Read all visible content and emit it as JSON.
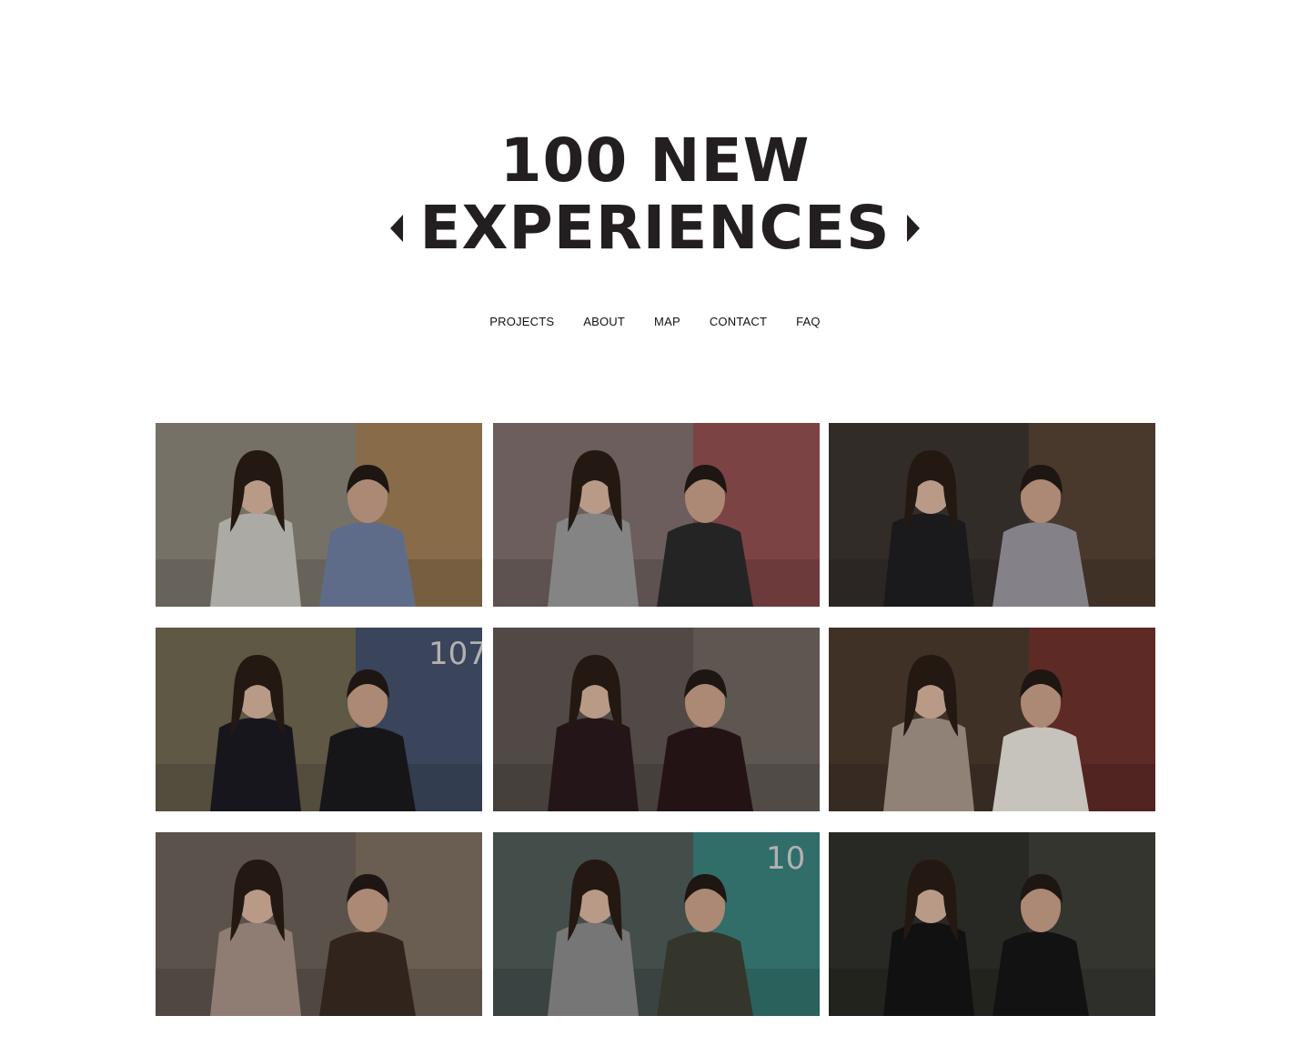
{
  "site": {
    "logo_line1": "100 NEW",
    "logo_line2": "EXPERIENCES"
  },
  "nav": [
    {
      "label": "PROJECTS"
    },
    {
      "label": "ABOUT"
    },
    {
      "label": "MAP"
    },
    {
      "label": "CONTACT"
    },
    {
      "label": "FAQ"
    }
  ],
  "gallery": {
    "tiles": [
      {
        "bg": "#8a8479",
        "accent": "#b07a3a",
        "p1": "#c9c6c0",
        "p2": "#6f7ea0",
        "sign": ""
      },
      {
        "bg": "#7d6e6c",
        "accent": "#a2343a",
        "p1": "#9a9a9a",
        "p2": "#2a2a2a",
        "sign": ""
      },
      {
        "bg": "#3b342f",
        "accent": "#6b4e38",
        "p1": "#1f1f22",
        "p2": "#9a97a0",
        "sign": ""
      },
      {
        "bg": "#6e6750",
        "accent": "#233f80",
        "p1": "#1c1a22",
        "p2": "#1a1a1e",
        "sign": "107"
      },
      {
        "bg": "#5e5651",
        "accent": "#7a726c",
        "p1": "#2a1a1c",
        "p2": "#2a1718",
        "sign": ""
      },
      {
        "bg": "#4b3a2e",
        "accent": "#8c2a2e",
        "p1": "#a8988a",
        "p2": "#e7e2db",
        "sign": ""
      },
      {
        "bg": "#6a6058",
        "accent": "#8a7a68",
        "p1": "#a79186",
        "p2": "#3a2a22",
        "sign": ""
      },
      {
        "bg": "#4e5a57",
        "accent": "#2aa39a",
        "p1": "#8a8a8a",
        "p2": "#3d3f33",
        "sign": "10"
      },
      {
        "bg": "#2f2f2a",
        "accent": "#4a4a44",
        "p1": "#141414",
        "p2": "#151515",
        "sign": ""
      }
    ]
  }
}
